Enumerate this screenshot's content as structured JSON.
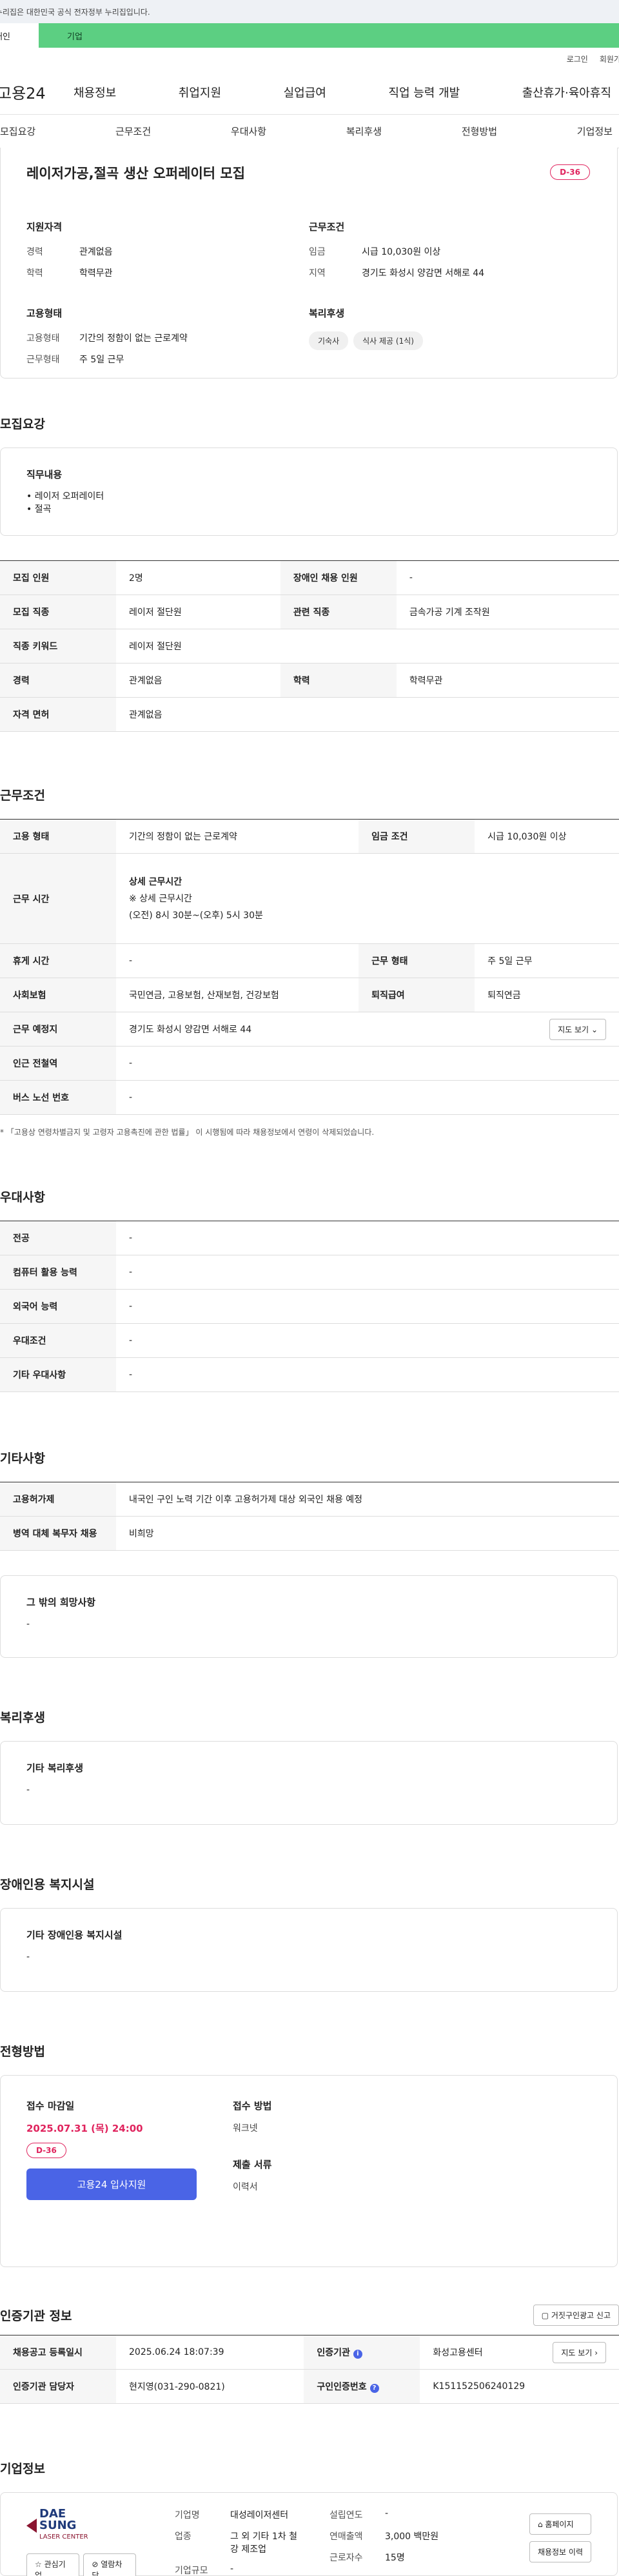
{
  "gov_banner": "이 누리집은 대한민국 공식 전자정부 누리집입니다.",
  "user_tabs": [
    "개인",
    "기업"
  ],
  "util": [
    "로그인",
    "회원가입"
  ],
  "logo": "고용24",
  "gnb": [
    "채용정보",
    "취업지원",
    "실업급여",
    "직업 능력 개발",
    "출산휴가·육아휴직"
  ],
  "anchors": [
    "모집요강",
    "근무조건",
    "우대사항",
    "복리후생",
    "전형방법",
    "기업정보"
  ],
  "summary": {
    "title": "레이저가공,절곡 생산 오퍼레이터 모집",
    "dday": "D-36",
    "qual_title": "지원자격",
    "qual": [
      {
        "k": "경력",
        "v": "관계없음"
      },
      {
        "k": "학력",
        "v": "학력무관"
      }
    ],
    "emp_title": "고용형태",
    "emp": [
      {
        "k": "고용형태",
        "v": "기간의 정함이 없는 근로계약"
      },
      {
        "k": "근무형태",
        "v": "주 5일 근무"
      }
    ],
    "cond_title": "근무조건",
    "cond": [
      {
        "k": "임금",
        "v": "시급 10,030원 이상"
      },
      {
        "k": "지역",
        "v": "경기도 화성시 양감면 서해로 44"
      }
    ],
    "welfare_title": "복리후생",
    "welfare_chips": [
      "기숙사",
      "식사 제공 (1식)"
    ]
  },
  "recruit": {
    "title": "모집요강",
    "duty_title": "직무내용",
    "duty_lines": [
      "• 레이저 오퍼레이터",
      "• 절곡"
    ],
    "rows": [
      [
        "모집 인원",
        "2명",
        "장애인 채용 인원",
        "-"
      ],
      [
        "모집 직종",
        "레이저 절단원",
        "관련 직종",
        "금속가공 기계 조작원"
      ],
      [
        "직종 키워드",
        "레이저 절단원",
        "",
        ""
      ],
      [
        "경력",
        "관계없음",
        "학력",
        "학력무관"
      ],
      [
        "자격 면허",
        "관계없음",
        "",
        ""
      ]
    ]
  },
  "work": {
    "title": "근무조건",
    "r1": [
      "고용 형태",
      "기간의 정함이 없는 근로계약",
      "임금 조건",
      "시급 10,030원 이상"
    ],
    "hours_label": "근무 시간",
    "hours_title": "상세 근무시간",
    "hours_sub": "※ 상세 근무시간",
    "hours_detail": "(오전) 8시 30분~(오후) 5시 30분",
    "r3": [
      "휴게 시간",
      "-",
      "근무 형태",
      "주 5일 근무"
    ],
    "r4": [
      "사회보험",
      "국민연금, 고용보험, 산재보험, 건강보험",
      "퇴직급여",
      "퇴직연금"
    ],
    "place_label": "근무 예정지",
    "place": "경기도 화성시 양감면 서해로 44",
    "map_btn": "지도 보기",
    "r6": [
      "인근 전철역",
      "-"
    ],
    "r7": [
      "버스 노선 번호",
      "-"
    ],
    "note": "* 「고용상 연령차별금지 및 고령자 고용촉진에 관한 법률」 이 시행됨에 따라 채용정보에서 연령이 삭제되었습니다."
  },
  "pref": {
    "title": "우대사항",
    "rows": [
      [
        "전공",
        "-"
      ],
      [
        "컴퓨터 활용 능력",
        "-"
      ],
      [
        "외국어 능력",
        "-"
      ],
      [
        "우대조건",
        "-"
      ],
      [
        "기타 우대사항",
        "-"
      ]
    ]
  },
  "etc": {
    "title": "기타사항",
    "rows": [
      [
        "고용허가제",
        "내국인 구인 노력 기간 이후 고용허가제 대상 외국인 채용 예정"
      ],
      [
        "병역 대체 복무자 채용",
        "비희망"
      ]
    ],
    "box_title": "그 밖의 희망사항",
    "box_val": "-"
  },
  "welfare": {
    "title": "복리후생",
    "box_title": "기타 복리후생",
    "box_val": "-"
  },
  "disab": {
    "title": "장애인용 복지시설",
    "box_title": "기타 장애인용 복지시설",
    "box_val": "-"
  },
  "process": {
    "title": "전형방법",
    "deadline_label": "접수 마감일",
    "deadline": "2025.07.31 (목) 24:00",
    "dday": "D-36",
    "apply": "고용24 입사지원",
    "method_label": "접수 방법",
    "method": "워크넷",
    "docs_label": "제출 서류",
    "docs": "이력서"
  },
  "org": {
    "title": "인증기관 정보",
    "report_btn": "거짓구인광고 신고",
    "r1": [
      "채용공고 등록일시",
      "2025.06.24 18:07:39",
      "인증기관",
      "화성고용센터"
    ],
    "r2": [
      "인증기관 담당자",
      "현지영(031-290-0821)",
      "구인인증번호",
      "K151152506240129"
    ],
    "map_btn": "지도 보기"
  },
  "corp": {
    "title": "기업정보",
    "logo_top": "DAE",
    "logo_mid": "SUNG",
    "logo_sub": "LASER CENTER",
    "fav_btn": "관심기업",
    "block_btn": "열람차단",
    "c1": [
      {
        "k": "기업명",
        "v": "대성레이저센터"
      },
      {
        "k": "업종",
        "v": "그 외 기타 1차 철강 제조업"
      },
      {
        "k": "기업규모",
        "v": "-"
      }
    ],
    "c2": [
      {
        "k": "설립연도",
        "v": "-"
      },
      {
        "k": "연매출액",
        "v": "3,000 백만원"
      },
      {
        "k": "근로자수",
        "v": "15명"
      }
    ],
    "home_btn": "홈페이지",
    "jobs_btn": "채용정보 이력"
  },
  "colors": {
    "accent": "#4a64e6",
    "dday": "#e0245e",
    "user_tab": "#5ccf82"
  }
}
